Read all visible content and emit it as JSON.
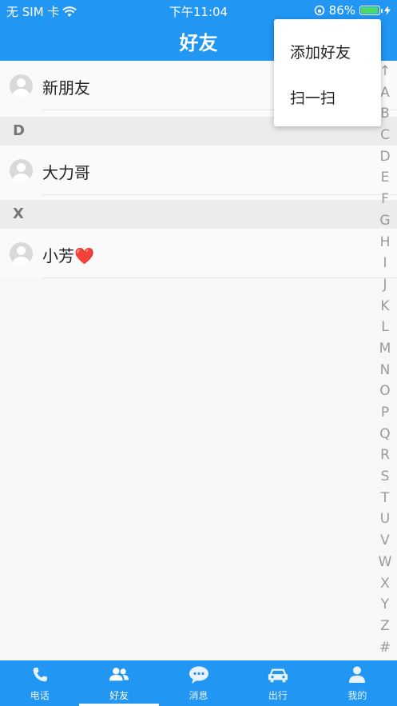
{
  "status": {
    "carrier": "无 SIM 卡",
    "time": "下午11:04",
    "battery": "86%",
    "battery_level": 0.86
  },
  "header": {
    "title": "好友"
  },
  "menu": {
    "items": [
      {
        "label": "添加好友"
      },
      {
        "label": "扫一扫"
      }
    ]
  },
  "contacts": {
    "new_friends": "新朋友",
    "sections": [
      {
        "letter": "D",
        "names": [
          "大力哥"
        ]
      },
      {
        "letter": "X",
        "names": [
          "小芳❤️"
        ]
      }
    ]
  },
  "index": [
    "↑",
    "A",
    "B",
    "C",
    "D",
    "E",
    "F",
    "G",
    "H",
    "I",
    "J",
    "K",
    "L",
    "M",
    "N",
    "O",
    "P",
    "Q",
    "R",
    "S",
    "T",
    "U",
    "V",
    "W",
    "X",
    "Y",
    "Z",
    "#"
  ],
  "tabs": [
    {
      "label": "电话",
      "icon": "phone-icon"
    },
    {
      "label": "好友",
      "icon": "friends-icon",
      "active": true
    },
    {
      "label": "消息",
      "icon": "message-icon"
    },
    {
      "label": "出行",
      "icon": "car-icon"
    },
    {
      "label": "我的",
      "icon": "profile-icon"
    }
  ],
  "colors": {
    "accent": "#2196f3",
    "battery": "#4cd964"
  }
}
